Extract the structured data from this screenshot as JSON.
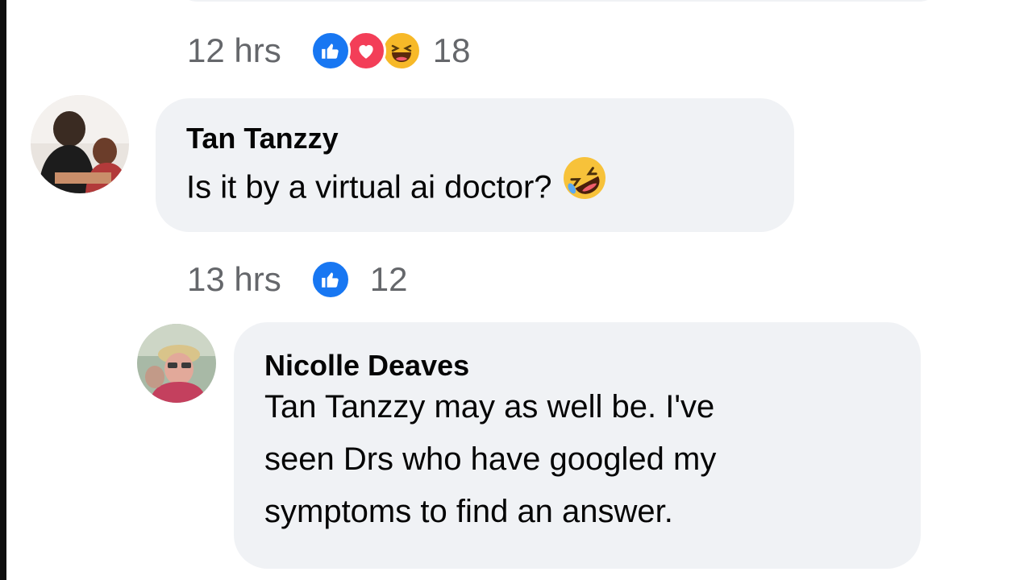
{
  "top_meta": {
    "time": "12 hrs",
    "reactions": [
      "like-icon",
      "love-icon",
      "haha-icon"
    ],
    "count": "18"
  },
  "comment1": {
    "author": "Tan Tanzzy",
    "text": "Is it by a virtual ai doctor?",
    "emoji": "rolling-on-floor-laughing-emoji",
    "time": "13 hrs",
    "reactions": [
      "like-icon"
    ],
    "count": "12"
  },
  "reply1": {
    "author": "Nicolle Deaves",
    "lines": [
      "Tan Tanzzy may as well be. I've",
      "seen Drs who have googled my",
      "symptoms to find an answer."
    ]
  },
  "colors": {
    "bubble": "#f0f2f5",
    "meta_text": "#65676b",
    "like": "#1877f2",
    "love": "#f33e58",
    "haha": "#f7b928"
  }
}
